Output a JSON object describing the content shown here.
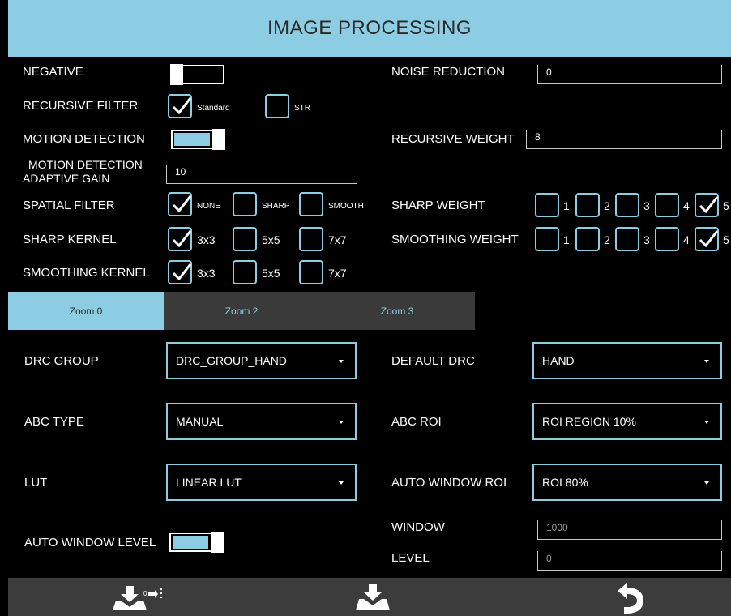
{
  "header": {
    "title": "IMAGE PROCESSING"
  },
  "left": {
    "negative": {
      "label": "NEGATIVE",
      "on": false
    },
    "recursive_filter": {
      "label": "RECURSIVE FILTER",
      "opt1": "Standard",
      "opt1_checked": true,
      "opt2": "STR",
      "opt2_checked": false
    },
    "motion_detection": {
      "label": "MOTION DETECTION",
      "on": true
    },
    "md_adaptive_gain": {
      "label_line1": "MOTION DETECTION",
      "label_line2": "ADAPTIVE GAIN",
      "value": "10"
    },
    "spatial_filter": {
      "label": "SPATIAL FILTER",
      "options": [
        "NONE",
        "SHARP",
        "SMOOTH"
      ],
      "selected": "NONE"
    },
    "sharp_kernel": {
      "label": "SHARP KERNEL",
      "options": [
        "3x3",
        "5x5",
        "7x7"
      ],
      "selected": "3x3"
    },
    "smoothing_kernel": {
      "label": "SMOOTHING KERNEL",
      "options": [
        "3x3",
        "5x5",
        "7x7"
      ],
      "selected": "3x3"
    }
  },
  "right": {
    "noise_reduction": {
      "label": "NOISE REDUCTION",
      "value": "0"
    },
    "recursive_weight": {
      "label": "RECURSIVE WEIGHT",
      "value": "8"
    },
    "sharp_weight": {
      "label": "SHARP WEIGHT",
      "options": [
        "1",
        "2",
        "3",
        "4",
        "5"
      ],
      "selected": "5"
    },
    "smoothing_weight": {
      "label": "SMOOTHING WEIGHT",
      "options": [
        "1",
        "2",
        "3",
        "4",
        "5"
      ],
      "selected": "5"
    }
  },
  "tabs": [
    {
      "label": "Zoom 0",
      "active": true
    },
    {
      "label": "Zoom 2",
      "active": false
    },
    {
      "label": "Zoom 3",
      "active": false
    }
  ],
  "zoom": {
    "drc_group": {
      "label": "DRC GROUP",
      "value": "DRC_GROUP_HAND"
    },
    "default_drc": {
      "label": "DEFAULT DRC",
      "value": "HAND"
    },
    "abc_type": {
      "label": "ABC TYPE",
      "value": "MANUAL"
    },
    "abc_roi": {
      "label": "ABC ROI",
      "value": "ROI REGION 10%"
    },
    "lut": {
      "label": "LUT",
      "value": "LINEAR LUT"
    },
    "auto_window_roi": {
      "label": "AUTO WINDOW ROI",
      "value": "ROI 80%"
    },
    "auto_window_level": {
      "label": "AUTO WINDOW LEVEL",
      "on": true
    },
    "window": {
      "label": "WINDOW",
      "value": "1000"
    },
    "level": {
      "label": "LEVEL",
      "value": "0"
    }
  },
  "footer": {
    "buttons": [
      "save-with-options-icon",
      "save-icon",
      "undo-icon"
    ]
  },
  "colors": {
    "accent": "#8ccde3",
    "footer": "#3c3c3c",
    "tab_bg": "#3a3a3a"
  }
}
